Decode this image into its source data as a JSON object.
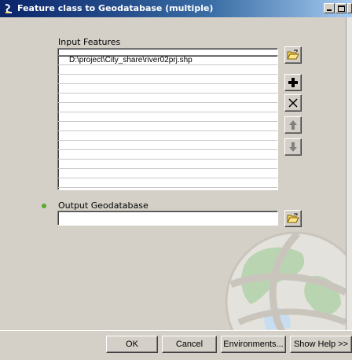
{
  "window": {
    "title": "Feature class to Geodatabase (multiple)"
  },
  "form": {
    "input_features_label": "Input Features",
    "input_features_value": "",
    "list_items": [
      "D:\\project\\City_share\\river02prj.shp",
      "",
      "",
      "",
      "",
      "",
      "",
      "",
      "",
      "",
      "",
      "",
      "",
      ""
    ],
    "output_geodatabase_label": "Output Geodatabase",
    "output_geodatabase_value": ""
  },
  "buttons": {
    "ok": "OK",
    "cancel": "Cancel",
    "environments": "Environments...",
    "show_help": "Show Help >>"
  },
  "icons": {
    "browse": "folder-open-icon",
    "add": "plus-icon",
    "remove": "x-icon",
    "up": "arrow-up-icon",
    "down": "arrow-down-icon",
    "required": "green-dot-icon"
  },
  "colors": {
    "titlebar_start": "#0a246a",
    "titlebar_end": "#a6caf0",
    "dialog_bg": "#d4d0c8",
    "required_dot": "#5aa832"
  }
}
